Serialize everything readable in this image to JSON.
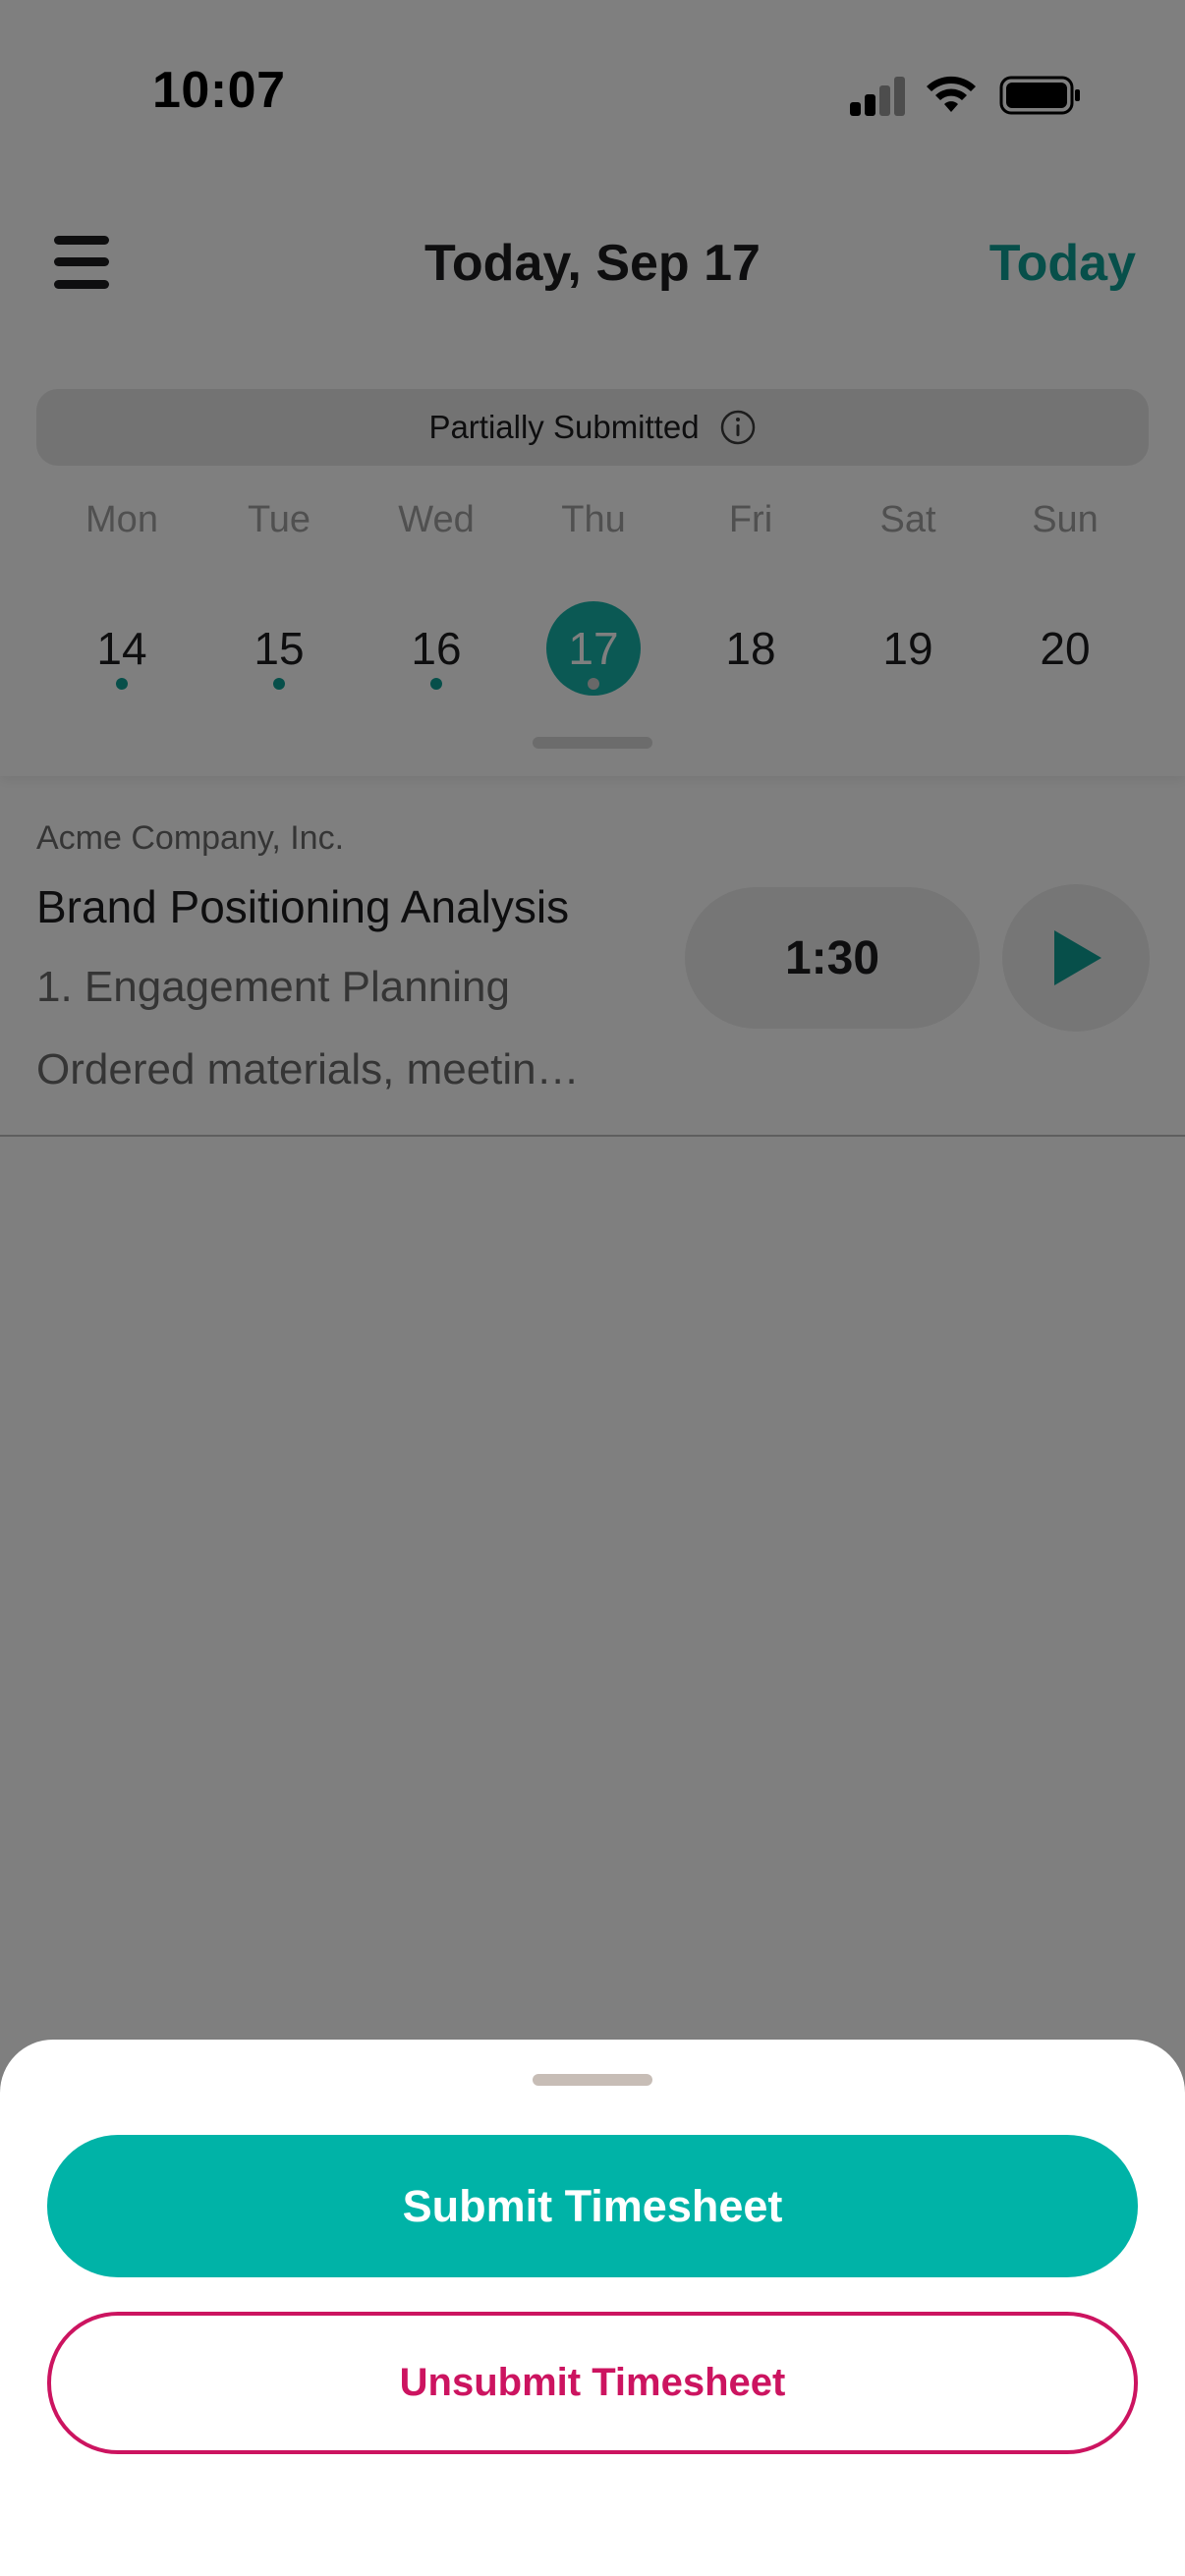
{
  "status_bar": {
    "time": "10:07"
  },
  "header": {
    "title": "Today, Sep 17",
    "today_label": "Today"
  },
  "timesheet_status": {
    "label": "Partially Submitted",
    "info_icon": "info-circle-icon"
  },
  "week": {
    "days": [
      {
        "name": "Mon",
        "number": "14",
        "has_entries": true,
        "selected": false
      },
      {
        "name": "Tue",
        "number": "15",
        "has_entries": true,
        "selected": false
      },
      {
        "name": "Wed",
        "number": "16",
        "has_entries": true,
        "selected": false
      },
      {
        "name": "Thu",
        "number": "17",
        "has_entries": true,
        "selected": true
      },
      {
        "name": "Fri",
        "number": "18",
        "has_entries": false,
        "selected": false
      },
      {
        "name": "Sat",
        "number": "19",
        "has_entries": false,
        "selected": false
      },
      {
        "name": "Sun",
        "number": "20",
        "has_entries": false,
        "selected": false
      }
    ]
  },
  "entries": [
    {
      "client": "Acme Company, Inc.",
      "project": "Brand Positioning Analysis",
      "task": "1. Engagement Planning",
      "notes": "Ordered materials, meeting notes",
      "duration": "1:30",
      "play_icon": "play-icon"
    }
  ],
  "sheet": {
    "submit_label": "Submit Timesheet",
    "unsubmit_label": "Unsubmit Timesheet"
  },
  "colors": {
    "accent": "#00b3a7",
    "accent_text": "#0e9f95",
    "danger": "#cc1460",
    "overlay": "rgba(0,0,0,0.5)"
  }
}
